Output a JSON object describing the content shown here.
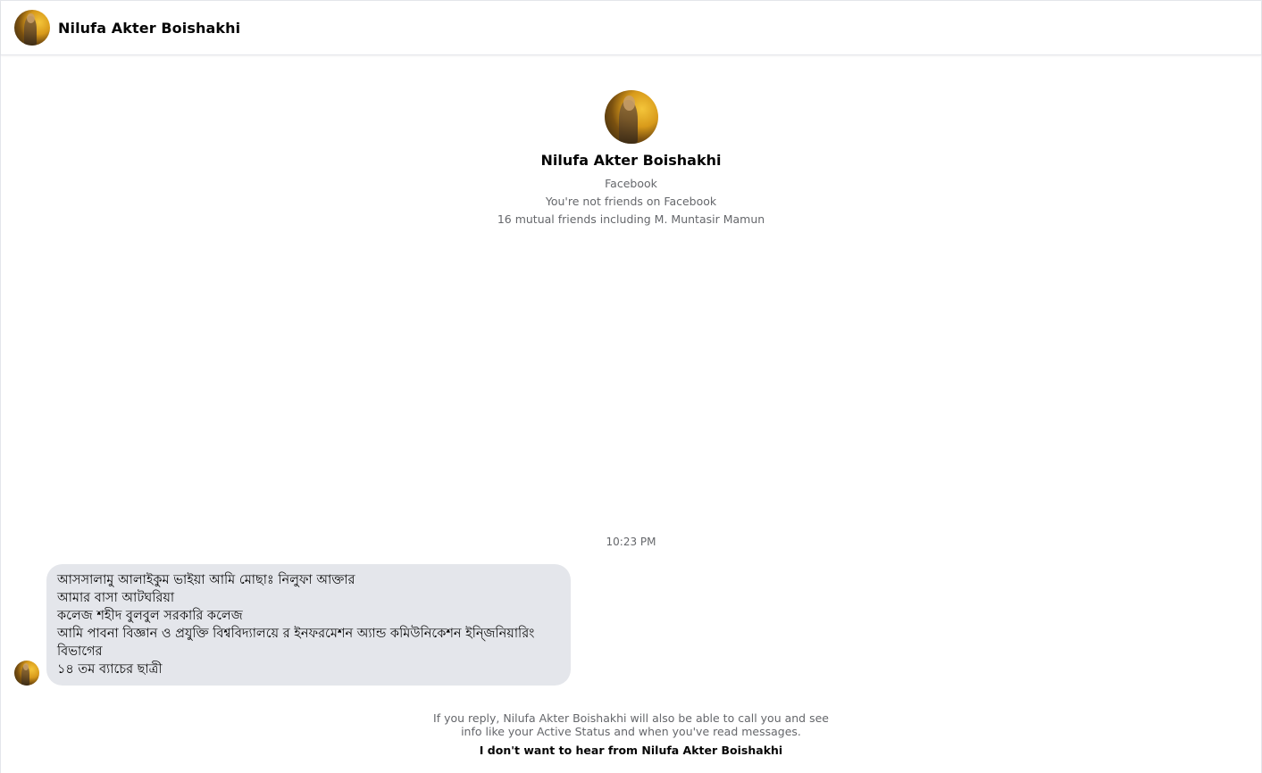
{
  "header": {
    "name": "Nilufa Akter Boishakhi",
    "avatar_icon": "profile-photo-avatar"
  },
  "profile": {
    "name": "Nilufa Akter Boishakhi",
    "platform": "Facebook",
    "friend_status": "You're not friends on Facebook",
    "mutual_friends": "16 mutual friends including M. Muntasir Mamun"
  },
  "conversation": {
    "timestamp": "10:23 PM",
    "message_lines": [
      "আসসালামু আলাইকুম ভাইয়া আমি মোছাঃ নিলুফা আক্তার",
      "আমার বাসা আটঘরিয়া",
      "কলেজ শহীদ বুলবুল সরকারি কলেজ",
      "আমি পাবনা বিজ্ঞান ও প্রযুক্তি বিশ্ববিদ্যালয়ে র  ইনফরমেশন অ্যান্ড কমিউনিকেশন ইন্জিনিয়ারিং",
      "বিভাগের",
      "১৪ তম ব্যাচের ছাত্রী"
    ]
  },
  "footer": {
    "note": "If you reply, Nilufa Akter Boishakhi will also be able to call you and see info like your Active Status and when you've read messages.",
    "ignore_link": "I don't want to hear from Nilufa Akter Boishakhi"
  },
  "colors": {
    "bubble_bg": "#e4e6eb",
    "secondary_text": "#65676b",
    "primary_text": "#050505"
  }
}
